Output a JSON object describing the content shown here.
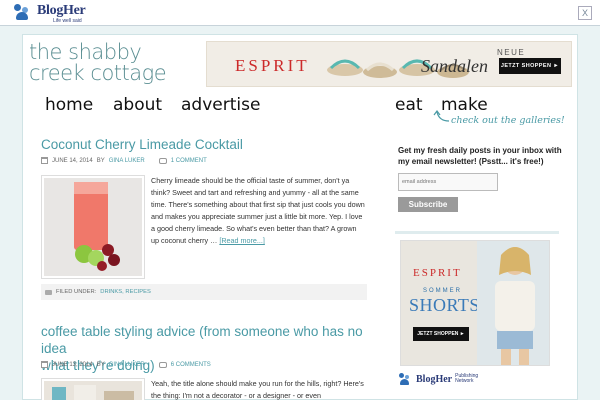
{
  "topbar": {
    "brand": "BlogHer",
    "tagline": "Life well said",
    "close_label": "X"
  },
  "site": {
    "logo_line1": "the shabby",
    "logo_line2": "creek cottage"
  },
  "ad_top": {
    "brand": "ESPRIT",
    "line1": "NEUE",
    "line2": "Sandalen",
    "cta": "JETZT SHOPPEN ►"
  },
  "nav": {
    "items": [
      "home",
      "about",
      "advertise",
      "eat",
      "make"
    ],
    "gallery_note": "check out the galleries!"
  },
  "posts": [
    {
      "title": "Coconut Cherry Limeade Cocktail",
      "date": "JUNE 14, 2014",
      "by": "BY",
      "author": "GINA LUKER",
      "comments": "1 COMMENT",
      "excerpt": "Cherry limeade should be the official taste of summer, don't ya think? Sweet and tart and refreshing and yummy - all at the same time. There's something about that first sip that just cools you down and makes you appreciate summer just a little bit more. Yep. I love a good cherry limeade. So what's even better than that? A grown up coconut cherry …",
      "read_more": "[Read more...]",
      "filed_label": "FILED UNDER:",
      "categories": "DRINKS, RECIPES"
    },
    {
      "title_line1": "coffee table styling advice (from someone who has no idea",
      "title_line2": "what they're doing)",
      "date": "JUNE 13, 2014",
      "by": "BY",
      "author": "GINA LUKER",
      "comments": "6 COMMENTS",
      "excerpt": "Yeah, the title alone should make you run for the hills, right? Here's the thing: I'm not a decorator - or a designer - or even"
    }
  ],
  "sidebar": {
    "newsletter_text": "Get my fresh daily posts in your inbox with my email newsletter! (Psstt... it's free!)",
    "email_placeholder": "email address",
    "subscribe_label": "Subscribe",
    "ad": {
      "brand": "ESPRIT",
      "sommer": "SOMMER",
      "shorts": "SHORTS",
      "cta": "JETZT SHOPPEN ►"
    },
    "network_brand": "BlogHer",
    "network_line1": "Publishing",
    "network_line2": "Network"
  },
  "colors": {
    "accent": "#4a9aa5",
    "esprit_red": "#cc2a2a",
    "blogher_navy": "#2a3b78"
  }
}
